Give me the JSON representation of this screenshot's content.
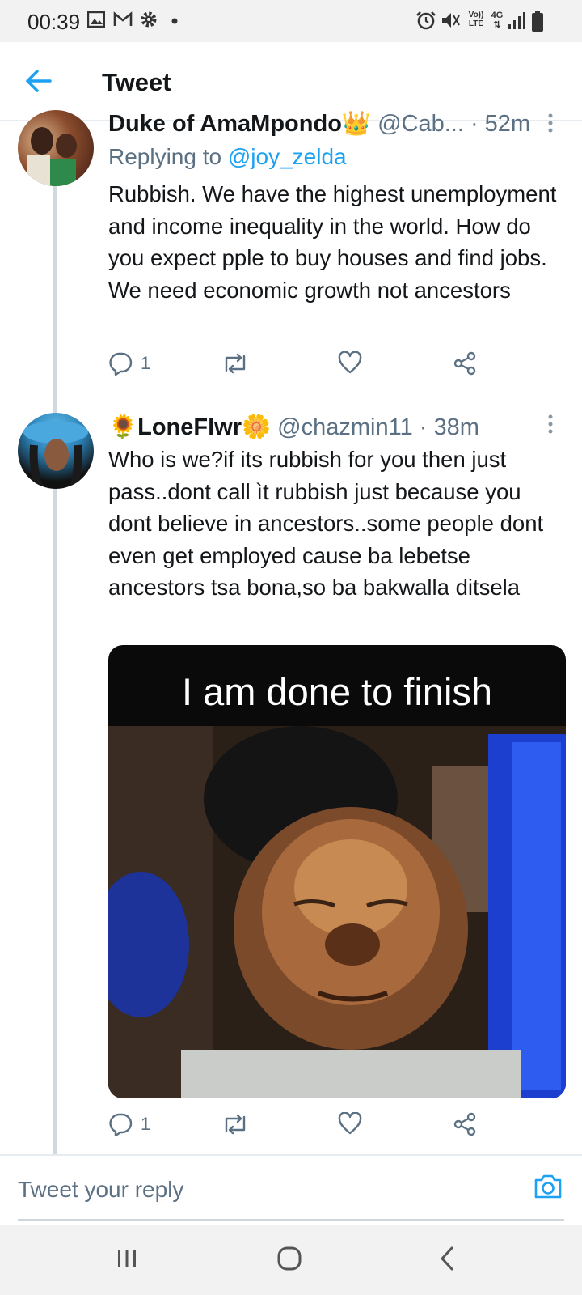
{
  "status_bar": {
    "time": "00:39",
    "icons": [
      "image-icon",
      "gmail-icon",
      "settings-icon",
      "dot-icon",
      "alarm-icon",
      "mute-icon",
      "volte-icon",
      "4g-icon",
      "signal-icon",
      "battery-icon"
    ],
    "volte_label": "Vo)) LTE",
    "network_label": "4G"
  },
  "header": {
    "title": "Tweet",
    "back_icon": "back-arrow-icon"
  },
  "tweets": [
    {
      "name": "Duke of AmaMpondo",
      "name_emoji": "👑",
      "handle": "@Cab...",
      "time": "· 52m",
      "replying_prefix": "Replying to",
      "replying_to": "@joy_zelda",
      "text": "Rubbish. We have the highest unemployment and income inequality in the world. How do you expect pple to buy houses and find jobs. We need economic growth not ancestors",
      "replies": "1"
    },
    {
      "name": "LoneFlwr",
      "name_emoji_left": "🌻",
      "name_emoji_right": "🌼",
      "handle": "@chazmin11",
      "time": "· 38m",
      "text": "Who is we?if its rubbish for you then just pass..dont call ìt rubbish just because you dont believe in ancestors..some people  dont even get employed cause ba lebetse ancestors tsa bona,so ba bakwalla ditsela",
      "media_caption": "I am done to finish",
      "replies": "1"
    }
  ],
  "reply_bar": {
    "placeholder": "Tweet your reply",
    "camera_icon": "camera-icon"
  },
  "nav_bar": {
    "buttons": [
      "recent-apps",
      "home",
      "back"
    ]
  },
  "colors": {
    "accent": "#1da1f2",
    "text": "#14171a",
    "secondary": "#5b7083",
    "divider": "#e6ecf0"
  }
}
